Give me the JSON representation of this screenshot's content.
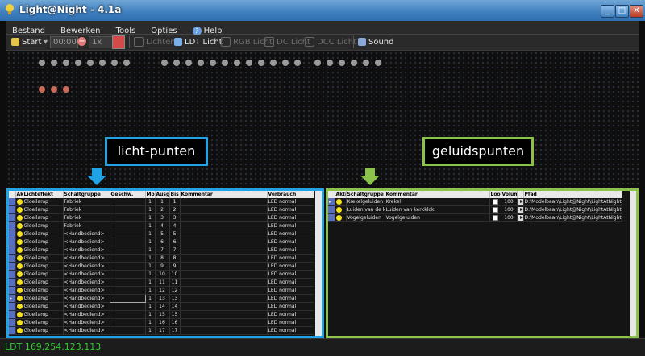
{
  "window": {
    "title": "Light@Night - 4.1a",
    "buttons": [
      "_",
      "□",
      "✕"
    ]
  },
  "menu": [
    "Bestand",
    "Bewerken",
    "Tools",
    "Opties",
    "Help"
  ],
  "toolbar": {
    "start": "Start",
    "time_value": "00:00",
    "speed_value": "1x",
    "items": [
      {
        "label": "Lichten",
        "enabled": false
      },
      {
        "label": "LDT Licht",
        "enabled": true
      },
      {
        "label": "RGB Licht",
        "enabled": false
      },
      {
        "label": "DC Licht",
        "enabled": false
      },
      {
        "label": "DCC Licht",
        "enabled": false
      },
      {
        "label": "Sound",
        "enabled": true
      }
    ]
  },
  "callouts": {
    "left": "licht-punten",
    "right": "geluidspunten"
  },
  "colors": {
    "left_accent": "#1fa3e6",
    "right_accent": "#8bc34a",
    "gray_dot": "#9a9a9a",
    "red_dot": "#c8695a",
    "status": "#2fcf2f"
  },
  "light_table": {
    "headers": [
      "",
      "Aktie",
      "Lichteffekt",
      "Schaltgruppe",
      "Geschw.",
      "Mo",
      "Ausg.",
      "Bis",
      "Kommentar",
      "Verbrauch"
    ],
    "rows": [
      [
        "Gloeilamp",
        "Fabriek",
        "",
        "1",
        "1",
        "1",
        "",
        "LED normal"
      ],
      [
        "Gloeilamp",
        "Fabriek",
        "",
        "1",
        "2",
        "2",
        "",
        "LED normal"
      ],
      [
        "Gloeilamp",
        "Fabriek",
        "",
        "1",
        "3",
        "3",
        "",
        "LED normal"
      ],
      [
        "Gloeilamp",
        "Fabriek",
        "",
        "1",
        "4",
        "4",
        "",
        "LED normal"
      ],
      [
        "Gloeilamp",
        "<Handbediend>",
        "",
        "1",
        "5",
        "5",
        "",
        "LED normal"
      ],
      [
        "Gloeilamp",
        "<Handbediend>",
        "",
        "1",
        "6",
        "6",
        "",
        "LED normal"
      ],
      [
        "Gloeilamp",
        "<Handbediend>",
        "",
        "1",
        "7",
        "7",
        "",
        "LED normal"
      ],
      [
        "Gloeilamp",
        "<Handbediend>",
        "",
        "1",
        "8",
        "8",
        "",
        "LED normal"
      ],
      [
        "Gloeilamp",
        "<Handbediend>",
        "",
        "1",
        "9",
        "9",
        "",
        "LED normal"
      ],
      [
        "Gloeilamp",
        "<Handbediend>",
        "",
        "1",
        "10",
        "10",
        "",
        "LED normal"
      ],
      [
        "Gloeilamp",
        "<Handbediend>",
        "",
        "1",
        "11",
        "11",
        "",
        "LED normal"
      ],
      [
        "Gloeilamp",
        "<Handbediend>",
        "",
        "1",
        "12",
        "12",
        "",
        "LED normal"
      ],
      [
        "Gloeilamp",
        "<Handbediend>",
        "",
        "1",
        "13",
        "13",
        "",
        "LED normal"
      ],
      [
        "Gloeilamp",
        "<Handbediend>",
        "",
        "1",
        "14",
        "14",
        "",
        "LED normal"
      ],
      [
        "Gloeilamp",
        "<Handbediend>",
        "",
        "1",
        "15",
        "15",
        "",
        "LED normal"
      ],
      [
        "Gloeilamp",
        "<Handbediend>",
        "",
        "1",
        "16",
        "16",
        "",
        "LED normal"
      ],
      [
        "Gloeilamp",
        "<Handbediend>",
        "",
        "1",
        "17",
        "17",
        "",
        "LED normal"
      ]
    ]
  },
  "sound_table": {
    "headers": [
      "",
      "Aktiv",
      "Schaltgruppe",
      "Kommentar",
      "Loop",
      "Volume",
      "",
      "Pfad"
    ],
    "rows": [
      [
        "Krekelgeluiden",
        "Krekel",
        "100",
        "D:\\Modelbaan\\Light@Night\\LightAtNight_geluid"
      ],
      [
        "Luiden van de kerkklok",
        "Luiden van kerkklok",
        "100",
        "D:\\Modelbaan\\Light@Night\\LightAtNight_geluid"
      ],
      [
        "Vogelgeluiden",
        "Vogelgeluiden",
        "100",
        "D:\\Modelbaan\\Light@Night\\LightAtNight_geluid"
      ]
    ]
  },
  "status": {
    "text": "LDT 169.254.123.113"
  }
}
